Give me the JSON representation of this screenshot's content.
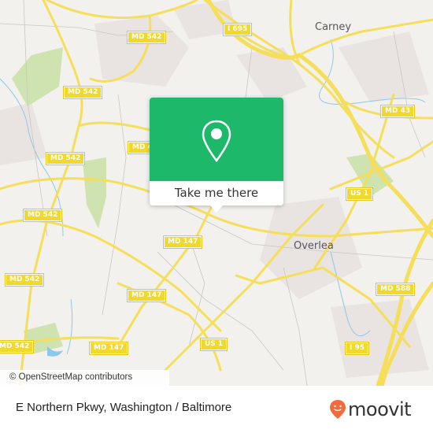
{
  "map": {
    "attribution": "© OpenStreetMap contributors",
    "places": [
      {
        "name": "Carney"
      },
      {
        "name": "Overlea"
      }
    ],
    "shields": [
      {
        "label": "MD 542"
      },
      {
        "label": "I 695"
      },
      {
        "label": "MD 542"
      },
      {
        "label": "MD 43"
      },
      {
        "label": "MD 4"
      },
      {
        "label": "MD 542"
      },
      {
        "label": "MD 542"
      },
      {
        "label": "US 1"
      },
      {
        "label": "MD 147"
      },
      {
        "label": "MD 542"
      },
      {
        "label": "MD 147"
      },
      {
        "label": "MD 588"
      },
      {
        "label": "MD 542"
      },
      {
        "label": "MD 147"
      },
      {
        "label": "US 1"
      },
      {
        "label": "I 95"
      }
    ],
    "colors": {
      "background": "#f2f1ee",
      "road": "#f5de5a",
      "park": "#c8e0a8",
      "water": "#8ec8e8",
      "urban": "#e8e2e0"
    }
  },
  "popup": {
    "icon": "map-pin-icon",
    "button_label": "Take me there",
    "accent": "#1eb86b"
  },
  "footer": {
    "location_title": "E Northern Pkwy, Washington / Baltimore",
    "brand": "moovit",
    "brand_color": "#f26b3a"
  }
}
